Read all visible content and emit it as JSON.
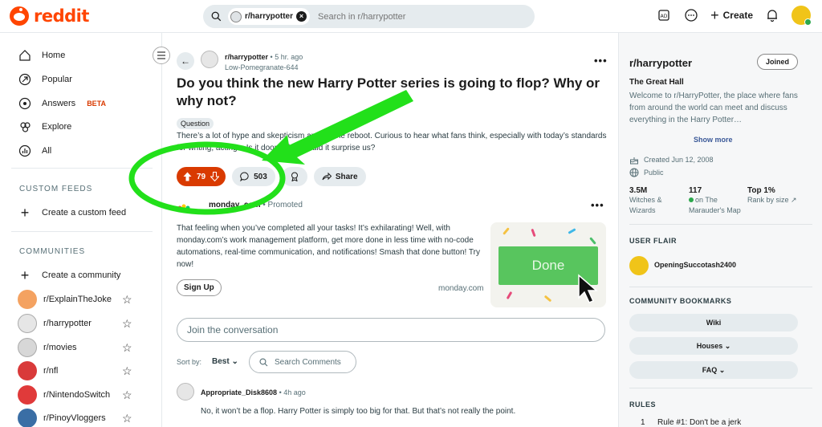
{
  "header": {
    "logo_text": "reddit",
    "search_chip": "r/harrypotter",
    "search_placeholder": "Search in r/harrypotter",
    "create_label": "Create"
  },
  "sidebar": {
    "nav": [
      {
        "label": "Home",
        "icon": "home-icon"
      },
      {
        "label": "Popular",
        "icon": "popular-icon"
      },
      {
        "label": "Answers",
        "badge": "BETA",
        "icon": "answers-icon"
      },
      {
        "label": "Explore",
        "icon": "explore-icon"
      },
      {
        "label": "All",
        "icon": "all-icon"
      }
    ],
    "custom_feeds_title": "CUSTOM FEEDS",
    "create_custom_feed": "Create a custom feed",
    "communities_title": "COMMUNITIES",
    "create_community": "Create a community",
    "communities": [
      {
        "name": "r/ExplainTheJoke",
        "color": "#f4a261"
      },
      {
        "name": "r/harrypotter",
        "color": "#e6e6e6"
      },
      {
        "name": "r/movies",
        "color": "#d7d7d7"
      },
      {
        "name": "r/nfl",
        "color": "#d93a3a"
      },
      {
        "name": "r/NintendoSwitch",
        "color": "#e03a3a"
      },
      {
        "name": "r/PinoyVloggers",
        "color": "#3a6ea5"
      }
    ]
  },
  "post": {
    "subreddit": "r/harrypotter",
    "time": "5 hr. ago",
    "author": "Low-Pomegranate-644",
    "title": "Do you think the new Harry Potter series is going to flop? Why or why not?",
    "flair": "Question",
    "body": "There’s a lot of hype and skepticism around the reboot. Curious to hear what fans think, especially with today’s standards for writing, acting... Is it doomed, or could it surprise us?",
    "votes": "79",
    "comments": "503",
    "share_label": "Share"
  },
  "ad": {
    "advertiser": "monday_com",
    "promoted": "Promoted",
    "body": "That feeling when you’ve completed all your tasks! It’s exhilarating! Well, with monday.com’s work management platform, get more done in less time with no-code automations, real-time communication, and notifications! Smash that done button! Try now!",
    "cta": "Sign Up",
    "domain": "monday.com",
    "image_button": "Done"
  },
  "comments_section": {
    "join_placeholder": "Join the conversation",
    "sort_label": "Sort by:",
    "sort_value": "Best",
    "search_comments": "Search Comments",
    "first_comment": {
      "author": "Appropriate_Disk8608",
      "time": "4h ago",
      "body": "No, it won’t be a flop. Harry Potter is simply too big for that. But that’s not really the point."
    }
  },
  "community": {
    "name": "r/harrypotter",
    "joined_label": "Joined",
    "subtitle": "The Great Hall",
    "description": "Welcome to r/HarryPotter, the place where fans from around the world can meet and discuss everything in the Harry Potter…",
    "show_more": "Show more",
    "created": "Created Jun 12, 2008",
    "visibility": "Public",
    "stats": [
      {
        "value": "3.5M",
        "label": "Witches & Wizards"
      },
      {
        "value": "117",
        "label": "on The Marauder's Map"
      },
      {
        "value": "Top 1%",
        "label": "Rank by size"
      }
    ],
    "user_flair_title": "USER FLAIR",
    "user_flair_name": "OpeningSuccotash2400",
    "bookmarks_title": "COMMUNITY BOOKMARKS",
    "bookmarks": [
      "Wiki",
      "Houses",
      "FAQ"
    ],
    "rules_title": "RULES",
    "first_rule_number": "1",
    "first_rule": "Rule #1: Don't be a jerk"
  },
  "colors": {
    "brand": "#ff4500",
    "upvote_active": "#d93a00",
    "annotation_green": "#22e01a"
  }
}
